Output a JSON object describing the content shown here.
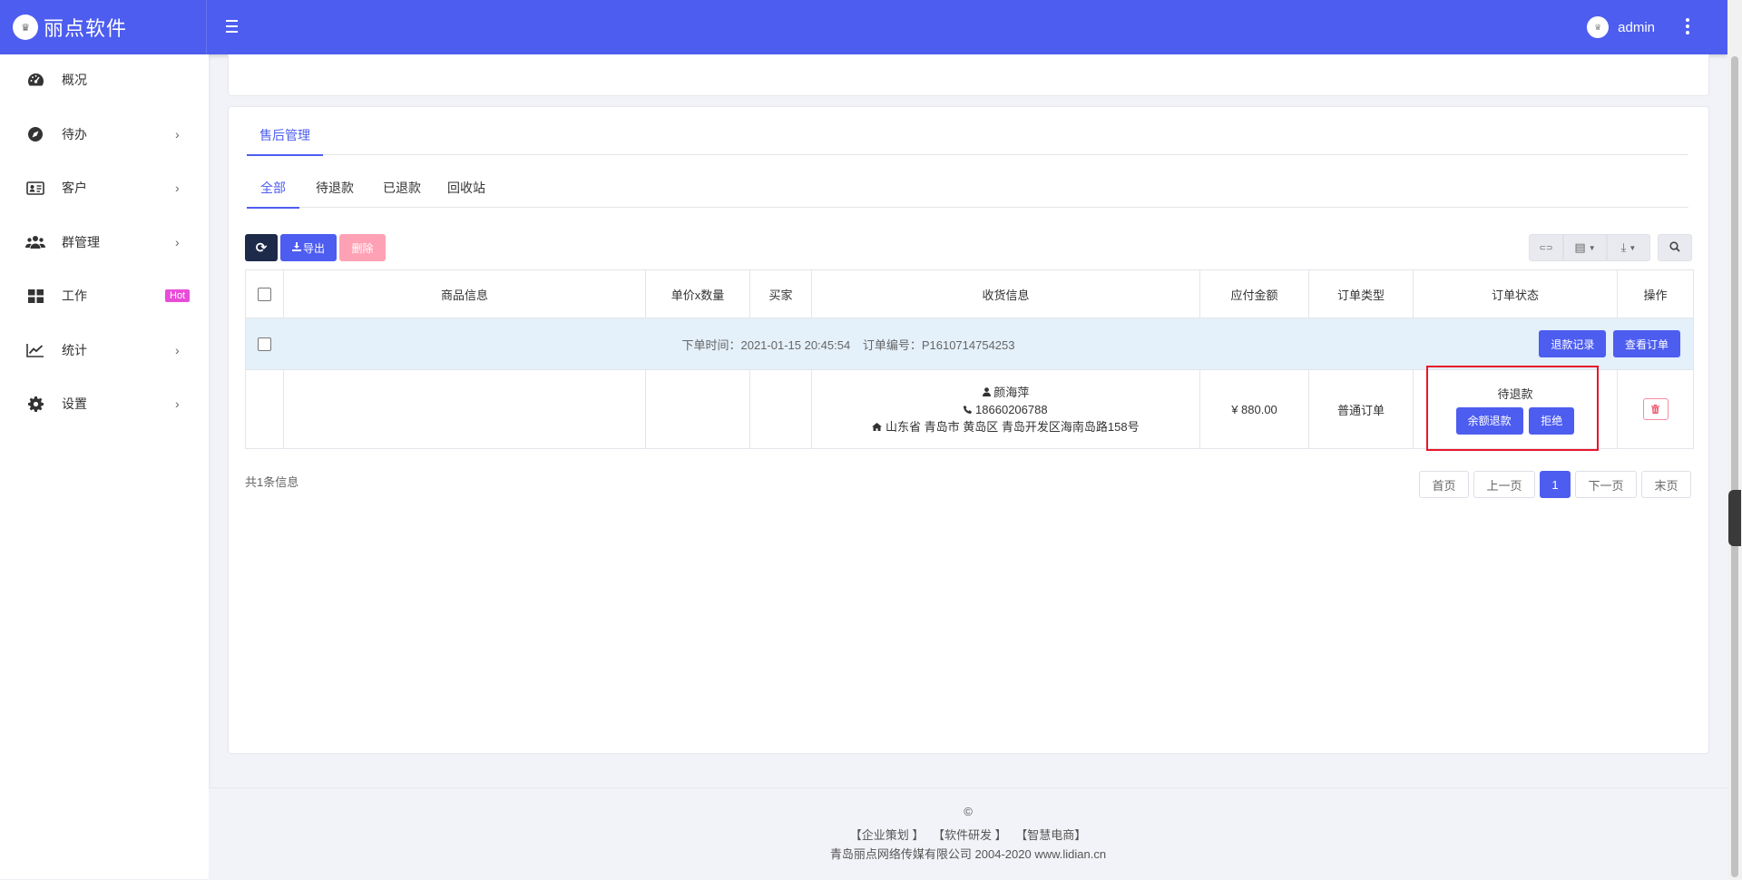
{
  "brand": {
    "name": "丽点软件",
    "logo_text": "♛"
  },
  "user": {
    "name": "admin",
    "avatar_text": "♛"
  },
  "sidebar": {
    "items": [
      {
        "label": "概况",
        "icon": "dashboard-icon",
        "has_chevron": false
      },
      {
        "label": "待办",
        "icon": "compass-icon",
        "has_chevron": true
      },
      {
        "label": "客户",
        "icon": "id-card-icon",
        "has_chevron": true
      },
      {
        "label": "群管理",
        "icon": "users-icon",
        "has_chevron": true
      },
      {
        "label": "工作",
        "icon": "grid-icon",
        "badge": "Hot"
      },
      {
        "label": "统计",
        "icon": "line-chart-icon",
        "has_chevron": true
      },
      {
        "label": "设置",
        "icon": "gear-icon",
        "has_chevron": true
      }
    ],
    "chevron": "›"
  },
  "tabs_main": [
    {
      "label": "售后管理",
      "active": true
    }
  ],
  "tabs_filter": [
    {
      "label": "全部",
      "active": true
    },
    {
      "label": "待退款",
      "active": false
    },
    {
      "label": "已退款",
      "active": false
    },
    {
      "label": "回收站",
      "active": false
    }
  ],
  "toolbar": {
    "refresh_icon": "⟳",
    "export_label": "导出",
    "delete_label": "删除",
    "columns_icon": "▤",
    "download_icon": "⤓",
    "toggle_icon": "⊂⊃",
    "search_icon": "search-icon"
  },
  "table": {
    "headers": [
      "商品信息",
      "单价x数量",
      "买家",
      "收货信息",
      "应付金额",
      "订单类型",
      "订单状态",
      "操作"
    ],
    "order": {
      "time_label": "下单时间：2021-01-15 20:45:54",
      "no_label": "订单编号：P1610714754253",
      "refund_record_btn": "退款记录",
      "view_order_btn": "查看订单"
    },
    "detail": {
      "name": "颜海萍",
      "phone": "18660206788",
      "address": "山东省 青岛市 黄岛区 青岛开发区海南岛路158号",
      "amount": "¥ 880.00",
      "order_type": "普通订单",
      "status": "待退款",
      "balance_refund_btn": "余额退款",
      "reject_btn": "拒绝"
    }
  },
  "pagination": {
    "total": "共1条信息",
    "first": "首页",
    "prev": "上一页",
    "current": "1",
    "next": "下一页",
    "last": "末页"
  },
  "footer": {
    "copy": "©",
    "links": [
      "【企业策划 】",
      "【软件研发 】",
      "【智慧电商】"
    ],
    "company": "青岛丽点网络传媒有限公司 2004-2020 www.lidian.cn"
  },
  "colors": {
    "primary": "#4d5df0",
    "dark": "#1e2a4a",
    "danger_light": "#ffa1b4",
    "highlight": "#e8162b",
    "hot": "#e94dd8"
  }
}
